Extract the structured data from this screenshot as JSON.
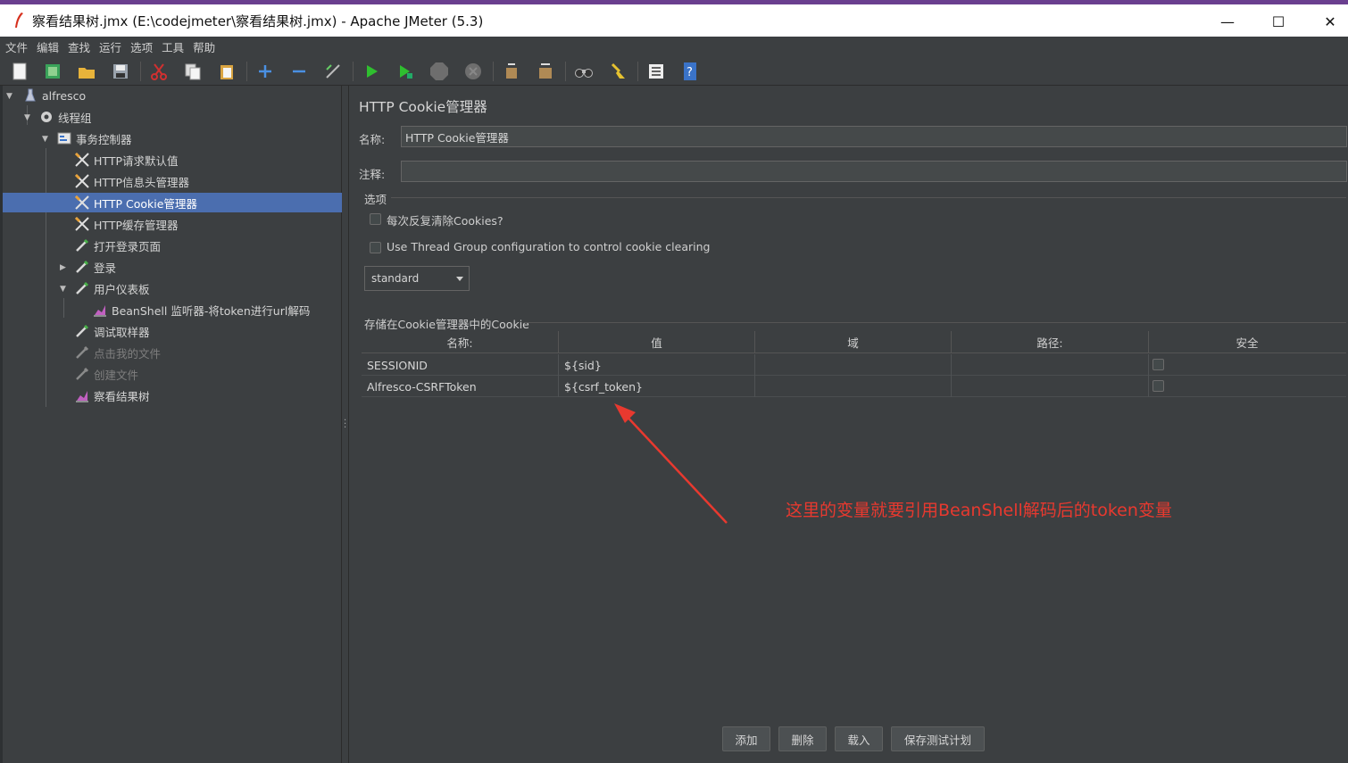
{
  "window": {
    "title": "察看结果树.jmx (E:\\codejmeter\\察看结果树.jmx) - Apache JMeter (5.3)",
    "minimize": "—",
    "maximize": "☐",
    "close": "✕"
  },
  "menu": [
    "文件",
    "编辑",
    "查找",
    "运行",
    "选项",
    "工具",
    "帮助"
  ],
  "tree": {
    "nodes": [
      {
        "label": "alfresco"
      },
      {
        "label": "线程组"
      },
      {
        "label": "事务控制器"
      },
      {
        "label": "HTTP请求默认值"
      },
      {
        "label": "HTTP信息头管理器"
      },
      {
        "label": "HTTP Cookie管理器"
      },
      {
        "label": "HTTP缓存管理器"
      },
      {
        "label": "打开登录页面"
      },
      {
        "label": "登录"
      },
      {
        "label": "用户仪表板"
      },
      {
        "label": "BeanShell 监听器-将token进行url解码"
      },
      {
        "label": "调试取样器"
      },
      {
        "label": "点击我的文件"
      },
      {
        "label": "创建文件"
      },
      {
        "label": "察看结果树"
      }
    ]
  },
  "panel": {
    "title": "HTTP Cookie管理器",
    "name_label": "名称:",
    "name_value": "HTTP Cookie管理器",
    "comment_label": "注释:",
    "comment_value": "",
    "options_label": "选项",
    "clear_each_iteration": "每次反复清除Cookies?",
    "use_thread_group": "Use Thread Group configuration to control cookie clearing",
    "policy": "standard",
    "stored_label": "存储在Cookie管理器中的Cookie"
  },
  "cookies_table": {
    "headers": [
      "名称:",
      "值",
      "域",
      "路径:",
      "安全"
    ],
    "rows": [
      {
        "name": "SESSIONID",
        "value": "${sid}",
        "domain": "",
        "path": ""
      },
      {
        "name": "Alfresco-CSRFToken",
        "value": "${csrf_token}",
        "domain": "",
        "path": ""
      }
    ]
  },
  "annotation": "这里的变量就要引用BeanShell解码后的token变量",
  "buttons": {
    "add": "添加",
    "delete": "删除",
    "load": "载入",
    "save": "保存测试计划"
  },
  "colors": {
    "background": "#3c3f41",
    "selection": "#4b6eaf",
    "annotation": "#e8392f"
  }
}
